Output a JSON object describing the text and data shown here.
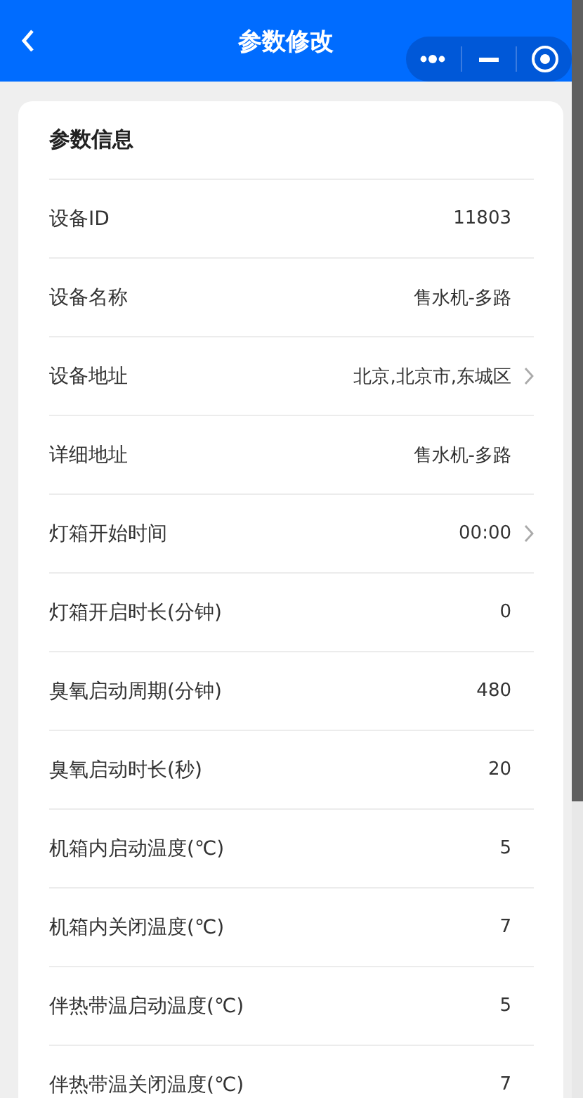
{
  "header": {
    "title": "参数修改"
  },
  "section": {
    "title": "参数信息"
  },
  "rows": [
    {
      "label": "设备ID",
      "value": "11803",
      "arrow": false
    },
    {
      "label": "设备名称",
      "value": "售水机-多路",
      "arrow": false
    },
    {
      "label": "设备地址",
      "value": "北京,北京市,东城区",
      "arrow": true
    },
    {
      "label": "详细地址",
      "value": "售水机-多路",
      "arrow": false
    },
    {
      "label": "灯箱开始时间",
      "value": "00:00",
      "arrow": true
    },
    {
      "label": "灯箱开启时长(分钟)",
      "value": "0",
      "arrow": false
    },
    {
      "label": "臭氧启动周期(分钟)",
      "value": "480",
      "arrow": false
    },
    {
      "label": "臭氧启动时长(秒)",
      "value": "20",
      "arrow": false
    },
    {
      "label": "机箱内启动温度(℃)",
      "value": "5",
      "arrow": false
    },
    {
      "label": "机箱内关闭温度(℃)",
      "value": "7",
      "arrow": false
    },
    {
      "label": "伴热带温启动温度(℃)",
      "value": "5",
      "arrow": false
    },
    {
      "label": "伴热带温关闭温度(℃)",
      "value": "7",
      "arrow": false
    }
  ]
}
